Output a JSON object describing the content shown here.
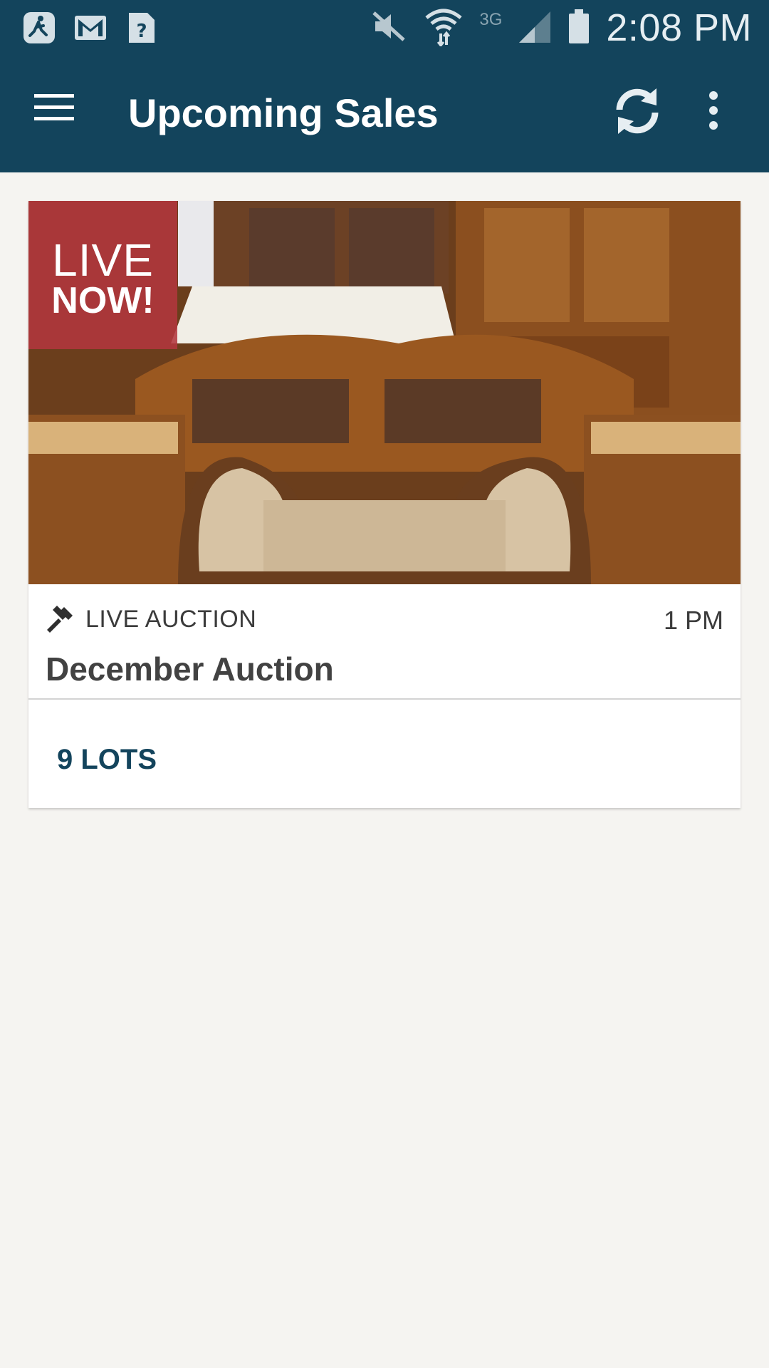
{
  "status_bar": {
    "left_icons": [
      "fitness-app-icon",
      "gmail-icon",
      "unknown-file-icon"
    ],
    "right_icons": [
      "mute-icon",
      "wifi-icon",
      "cellular-signal-icon",
      "battery-icon"
    ],
    "network_label": "3G",
    "time": "2:08 PM"
  },
  "app_bar": {
    "title": "Upcoming Sales",
    "background": "#13445c"
  },
  "sale_card": {
    "badge": {
      "line1": "LIVE",
      "line2": "NOW!",
      "color": "#b2373e"
    },
    "type_label": "LIVE AUCTION",
    "time": "1 PM",
    "title": "December Auction",
    "lots_label": "9 LOTS"
  }
}
